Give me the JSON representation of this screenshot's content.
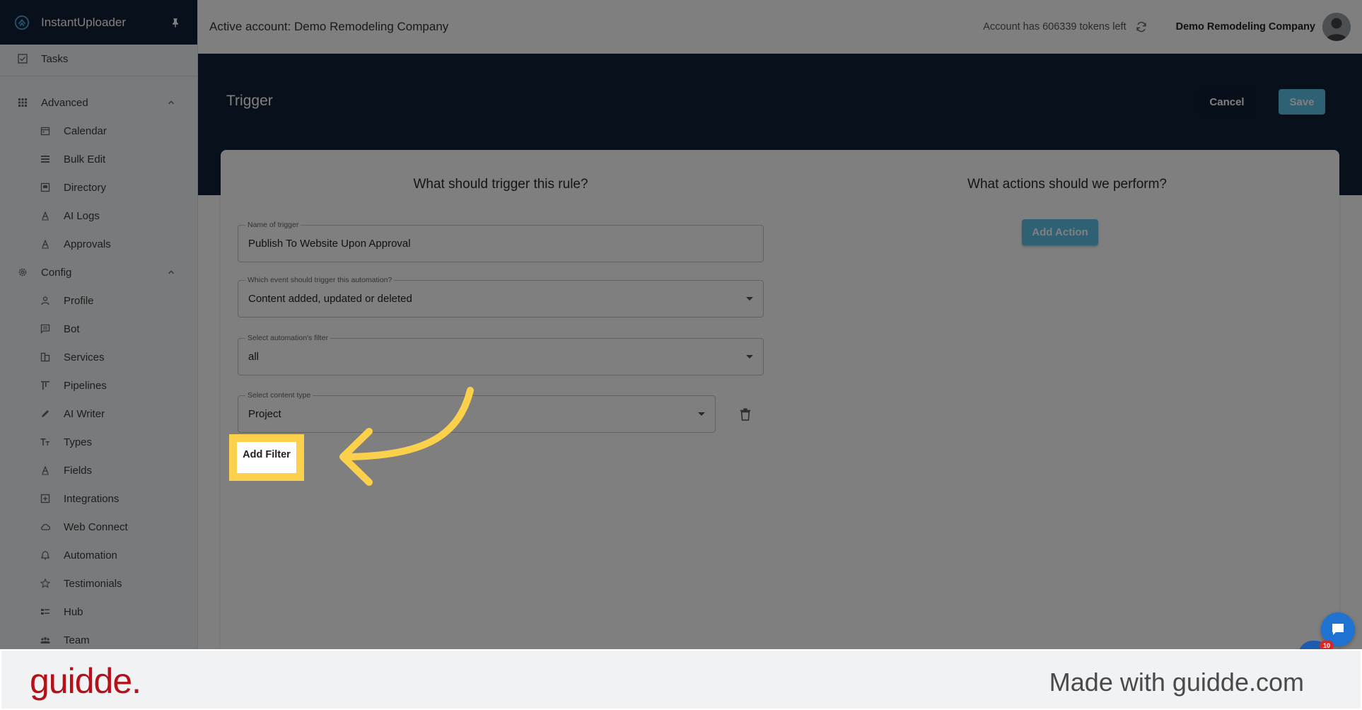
{
  "app": {
    "name": "InstantUploader"
  },
  "sidebar": {
    "items": [
      {
        "label": "Tasks",
        "icon": "checkbox-icon",
        "level": "top"
      },
      {
        "label": "Advanced",
        "icon": "grid-icon",
        "level": "top",
        "expanded": true
      },
      {
        "label": "Calendar",
        "icon": "calendar-icon",
        "level": "sub"
      },
      {
        "label": "Bulk Edit",
        "icon": "list-icon",
        "level": "sub"
      },
      {
        "label": "Directory",
        "icon": "directory-icon",
        "level": "sub"
      },
      {
        "label": "AI Logs",
        "icon": "letter-a-icon",
        "level": "sub"
      },
      {
        "label": "Approvals",
        "icon": "letter-a-icon",
        "level": "sub"
      },
      {
        "label": "Config",
        "icon": "gear-icon",
        "level": "top",
        "expanded": true
      },
      {
        "label": "Profile",
        "icon": "person-icon",
        "level": "sub"
      },
      {
        "label": "Bot",
        "icon": "chat-icon",
        "level": "sub"
      },
      {
        "label": "Services",
        "icon": "services-icon",
        "level": "sub"
      },
      {
        "label": "Pipelines",
        "icon": "pipeline-icon",
        "level": "sub"
      },
      {
        "label": "AI Writer",
        "icon": "pencil-icon",
        "level": "sub"
      },
      {
        "label": "Types",
        "icon": "text-type-icon",
        "level": "sub"
      },
      {
        "label": "Fields",
        "icon": "letter-a-icon",
        "level": "sub"
      },
      {
        "label": "Integrations",
        "icon": "plus-box-icon",
        "level": "sub"
      },
      {
        "label": "Web Connect",
        "icon": "cloud-icon",
        "level": "sub"
      },
      {
        "label": "Automation",
        "icon": "bell-icon",
        "level": "sub"
      },
      {
        "label": "Testimonials",
        "icon": "star-icon",
        "level": "sub"
      },
      {
        "label": "Hub",
        "icon": "hub-icon",
        "level": "sub"
      },
      {
        "label": "Team",
        "icon": "team-icon",
        "level": "sub"
      }
    ]
  },
  "topbar": {
    "active_account": "Active account: Demo Remodeling Company",
    "tokens": "Account has 606339 tokens left",
    "company": "Demo Remodeling Company"
  },
  "header": {
    "title": "Trigger",
    "cancel_label": "Cancel",
    "save_label": "Save"
  },
  "trigger_form": {
    "heading": "What should trigger this rule?",
    "name_label": "Name of trigger",
    "name_value": "Publish To Website Upon Approval",
    "event_label": "Which event should trigger this automation?",
    "event_value": "Content added, updated or deleted",
    "filter_label": "Select automation's filter",
    "filter_value": "all",
    "content_type_label": "Select content type",
    "content_type_value": "Project",
    "add_filter_label": "Add Filter"
  },
  "actions": {
    "heading": "What actions should we perform?",
    "add_action_label": "Add Action"
  },
  "chat": {
    "badge": "10"
  },
  "footer": {
    "logo": "guidde.",
    "made_with": "Made with guidde.com"
  },
  "colors": {
    "navy": "#102237",
    "accent": "#5fc2ea",
    "highlight": "#fbd14b",
    "brand_red": "#b4111b"
  }
}
